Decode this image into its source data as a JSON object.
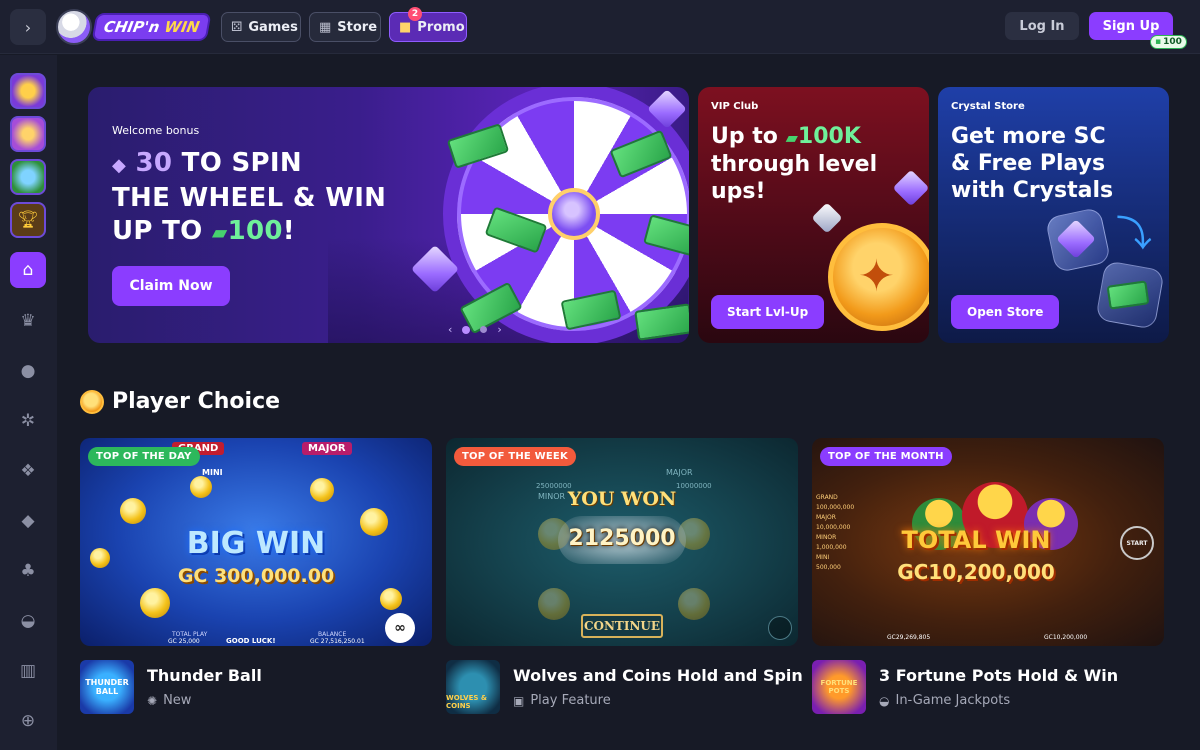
{
  "header": {
    "logo_text_a": "CHIP'n",
    "logo_text_b": "WIN",
    "nav": [
      {
        "label": "Games",
        "icon": "dice-icon"
      },
      {
        "label": "Store",
        "icon": "store-icon"
      },
      {
        "label": "Promo",
        "icon": "gift-icon",
        "badge": "2"
      }
    ],
    "login_label": "Log In",
    "signup_label": "Sign Up",
    "signup_bonus": "100"
  },
  "sidebar": {
    "items": [
      "collapse",
      "game-thumb-1",
      "game-thumb-2",
      "game-thumb-3",
      "trophy",
      "home",
      "crown",
      "drop",
      "gear",
      "dog",
      "fish",
      "cherry",
      "pot",
      "chest",
      "crosshair"
    ]
  },
  "banners": {
    "main": {
      "label": "Welcome bonus",
      "line1_amount": "30",
      "line1_text": "TO SPIN",
      "line2_text": "THE WHEEL & WIN",
      "line3_prefix": "UP TO",
      "line3_amount": "100",
      "line3_suffix": "!",
      "button": "Claim Now",
      "carousel_prev": "‹",
      "carousel_next": "›"
    },
    "vip": {
      "label": "VIP Club",
      "title_prefix": "Up to",
      "title_amount": "100K",
      "title_rest": "through level ups!",
      "button": "Start Lvl-Up"
    },
    "crystal": {
      "label": "Crystal Store",
      "title": "Get more SC & Free Plays with Crystals",
      "button": "Open Store"
    }
  },
  "section": {
    "title": "Player Choice"
  },
  "games": [
    {
      "tag": "TOP OF THE DAY",
      "big_text": "BIG WIN",
      "amount_text": "GC 300,000.00",
      "name": "Thunder Ball",
      "sub": "New",
      "sub_icon": "sparkle-icon",
      "thumb_text": "THUNDER BALL",
      "hud_grand": "GRAND",
      "hud_major": "MAJOR",
      "hud_mini": "MINI",
      "hud_good_luck": "GOOD LUCK!",
      "hud_total_play": "TOTAL PLAY",
      "hud_balance": "BALANCE",
      "hud_gc_left": "GC 25,000",
      "hud_gc_right": "GC 27,516,250.01"
    },
    {
      "tag": "TOP OF THE WEEK",
      "big_text": "YOU WON",
      "amount_text": "2125000",
      "button_text": "CONTINUE",
      "name": "Wolves and Coins Hold and Spin",
      "sub": "Play Feature",
      "sub_icon": "gift-icon",
      "thumb_text": "WOLVES & COINS",
      "hud_major": "MAJOR",
      "hud_minor": "MINOR",
      "hud_values": [
        "25000000",
        "10000000"
      ]
    },
    {
      "tag": "TOP OF THE MONTH",
      "big_text": "TOTAL WIN",
      "amount_text": "GC10,200,000",
      "name": "3 Fortune Pots Hold & Win",
      "sub": "In-Game Jackpots",
      "sub_icon": "pot-icon",
      "thumb_text": "FORTUNE POTS",
      "hud_start": "START",
      "hud_values": [
        "GC29,269,805",
        "GC10,200,000"
      ],
      "hud_side": [
        "GRAND",
        "100,000,000",
        "MAJOR",
        "10,000,000",
        "MINOR",
        "1,000,000",
        "MINI",
        "500,000"
      ]
    }
  ]
}
